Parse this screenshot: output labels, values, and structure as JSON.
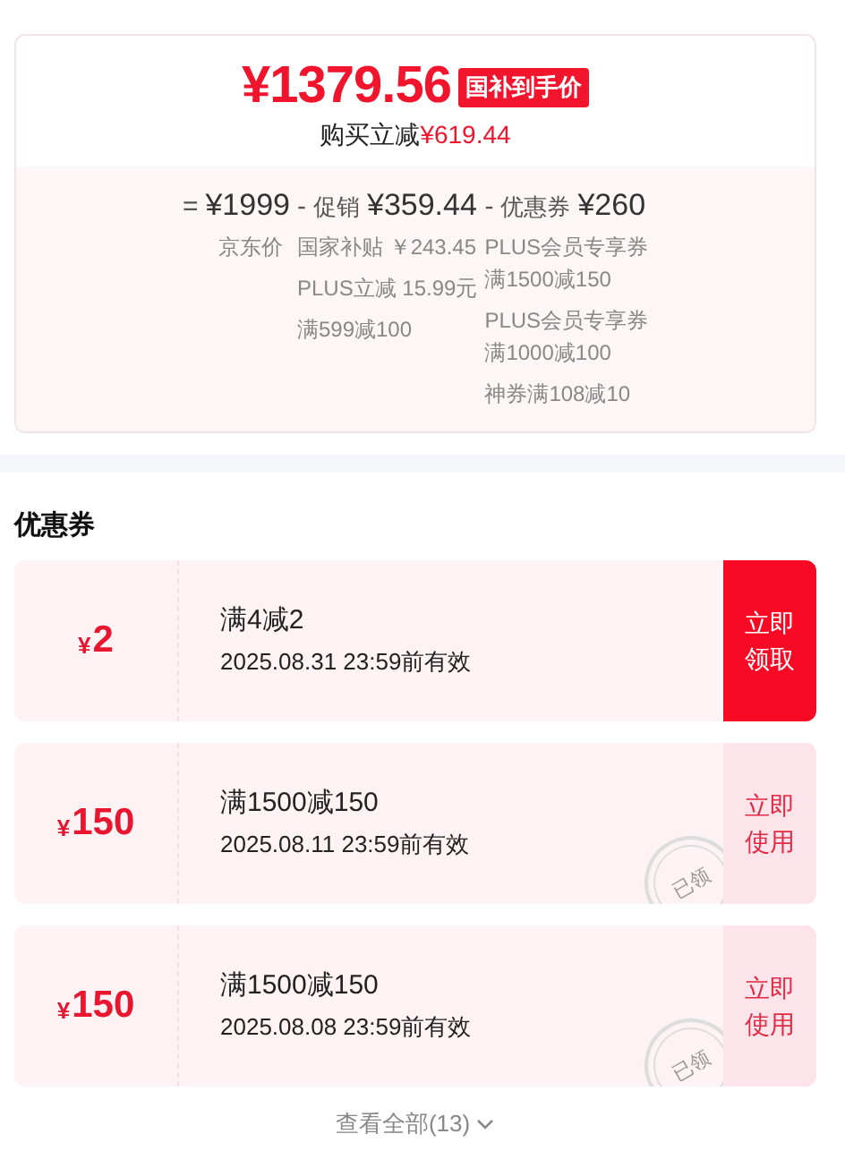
{
  "price": {
    "amount": "¥1379.56",
    "tag": "国补到手价",
    "saving_label": "购买立减",
    "saving_amount": "¥619.44"
  },
  "breakdown": [
    {
      "operator": "=",
      "amount": "¥1999",
      "details": [
        {
          "lines": [
            "京东价"
          ]
        }
      ]
    },
    {
      "operator": "-",
      "label": "促销",
      "amount": "¥359.44",
      "details": [
        {
          "lines": [
            "国家补贴 ￥243.45"
          ]
        },
        {
          "lines": [
            "PLUS立减 15.99元"
          ]
        },
        {
          "lines": [
            "满599减100"
          ]
        }
      ]
    },
    {
      "operator": "-",
      "label": "优惠券",
      "amount": "¥260",
      "details": [
        {
          "lines": [
            "PLUS会员专享券",
            "满1500减150"
          ]
        },
        {
          "lines": [
            "PLUS会员专享券",
            "满1000减100"
          ]
        },
        {
          "lines": [
            "神券满108减10"
          ]
        }
      ]
    }
  ],
  "coupon_section": {
    "title": "优惠券"
  },
  "coupons": [
    {
      "currency": "¥",
      "value": "2",
      "condition": "满4减2",
      "validity": "2025.08.31 23:59前有效",
      "action": "立即领取",
      "claimed": false
    },
    {
      "currency": "¥",
      "value": "150",
      "condition": "满1500减150",
      "validity": "2025.08.11 23:59前有效",
      "action": "立即使用",
      "claimed": true,
      "stamp": "已领"
    },
    {
      "currency": "¥",
      "value": "150",
      "condition": "满1500减150",
      "validity": "2025.08.08 23:59前有效",
      "action": "立即使用",
      "claimed": true,
      "stamp": "已领"
    }
  ],
  "view_all": "查看全部(13)"
}
